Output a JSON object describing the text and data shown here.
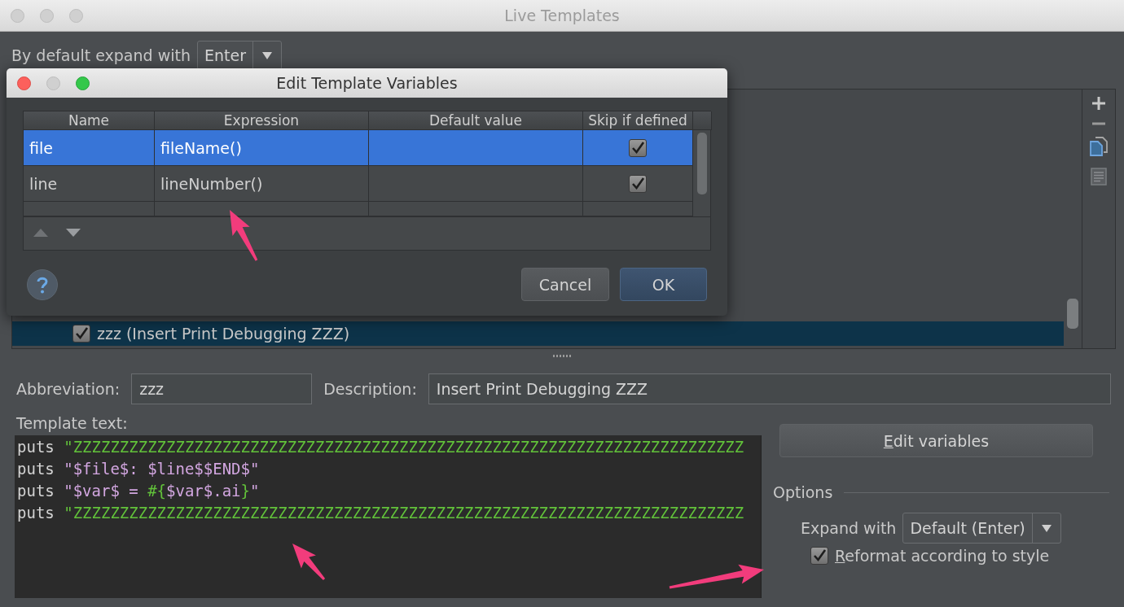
{
  "window": {
    "title": "Live Templates"
  },
  "expand_default": {
    "label": "By default expand with",
    "value": "Enter"
  },
  "templates": [
    {
      "label": "zzz (Insert Print Debugging ZZZ)",
      "checked": true,
      "selected": true
    }
  ],
  "abbreviation": {
    "label": "Abbreviation:",
    "value": "zzz"
  },
  "description": {
    "label": "Description:",
    "value": "Insert Print Debugging ZZZ"
  },
  "template_text": {
    "label": "Template text:",
    "lines": [
      [
        {
          "kind": "plain",
          "text": "puts "
        },
        {
          "kind": "string",
          "text": "\"ZZZZZZZZZZZZZZZZZZZZZZZZZZZZZZZZZZZZZZZZZZZZZZZZZZZZZZZZZZZZZZZZZZZZZZZZ"
        }
      ],
      [
        {
          "kind": "plain",
          "text": "puts "
        },
        {
          "kind": "template",
          "text": "\"$file$: $line$$END$\""
        }
      ],
      [
        {
          "kind": "plain",
          "text": "puts "
        },
        {
          "kind": "template",
          "text": "\"$var$ = "
        },
        {
          "kind": "string",
          "text": "#{"
        },
        {
          "kind": "template",
          "text": "$var$.ai"
        },
        {
          "kind": "string",
          "text": "}"
        },
        {
          "kind": "template",
          "text": "\""
        }
      ],
      [
        {
          "kind": "plain",
          "text": "puts "
        },
        {
          "kind": "string",
          "text": "\"ZZZZZZZZZZZZZZZZZZZZZZZZZZZZZZZZZZZZZZZZZZZZZZZZZZZZZZZZZZZZZZZZZZZZZZZZ"
        }
      ]
    ]
  },
  "edit_variables": {
    "label": "Edit variables",
    "underline_first": true
  },
  "options": {
    "title": "Options",
    "expand_with": {
      "label": "Expand with",
      "value": "Default (Enter)"
    },
    "reformat": {
      "label": "Reformat according to style",
      "checked": true,
      "underline_first": true
    }
  },
  "dialog": {
    "title": "Edit Template Variables",
    "columns": [
      "Name",
      "Expression",
      "Default value",
      "Skip if defined"
    ],
    "rows": [
      {
        "name": "file",
        "expression": "fileName()",
        "skip_if_defined": true,
        "selected": true
      },
      {
        "name": "line",
        "expression": "lineNumber()",
        "skip_if_defined": true,
        "selected": false
      }
    ],
    "buttons": [
      {
        "label": "Cancel",
        "kind": "secondary"
      },
      {
        "label": "OK",
        "kind": "default"
      }
    ]
  }
}
